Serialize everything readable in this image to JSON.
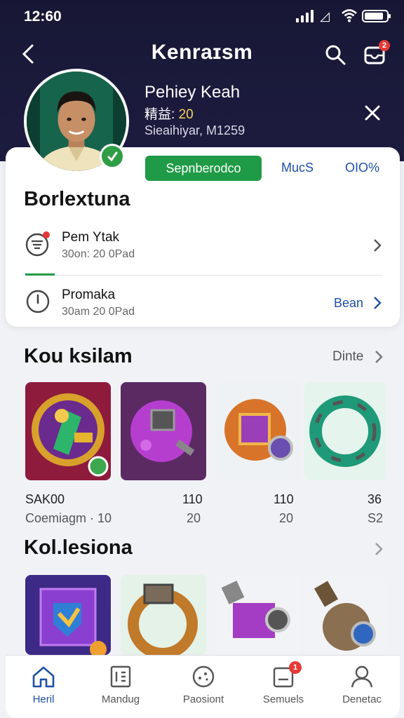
{
  "status_bar": {
    "time": "12:60"
  },
  "header": {
    "title": "Kenraɪsm",
    "notification_count": "2"
  },
  "profile": {
    "name": "Pehiey Keah",
    "level_label": "精益:",
    "level_value": "20",
    "meta": "Sieaihiyar, M1259"
  },
  "card": {
    "primary_button": "Sepnberodco",
    "link_1": "MucS",
    "link_2": "OIO%",
    "title": "Borlextuna",
    "rows": [
      {
        "title": "Pem Ytak",
        "subtitle": "30on: 20 0Pad",
        "action": ""
      },
      {
        "title": "Promaka",
        "subtitle": "30am 20 0Pad",
        "action": "Bean"
      }
    ]
  },
  "section1": {
    "title": "Kou ksilam",
    "more": "Dinte",
    "items": [
      {
        "name": "SAK00",
        "stat": "110",
        "sub": "Coemiagm · 10",
        "sub_stat": "20"
      },
      {
        "name": "",
        "stat": "110",
        "sub": "",
        "sub_stat": "20"
      },
      {
        "name": "",
        "stat": "36",
        "sub": "",
        "sub_stat": "S2"
      }
    ]
  },
  "section2": {
    "title": "Kol.lesiona"
  },
  "bottom_nav": [
    {
      "label": "Heril",
      "icon": "home-icon"
    },
    {
      "label": "Mandug",
      "icon": "list-icon"
    },
    {
      "label": "Paosiont",
      "icon": "compass-icon"
    },
    {
      "label": "Semuels",
      "icon": "inbox-icon",
      "badge": "1"
    },
    {
      "label": "Denetac",
      "icon": "profile-icon"
    }
  ],
  "colors": {
    "accent_green": "#1f9a46",
    "link_blue": "#1f4fa8",
    "header_bg": "#1b1a3a"
  }
}
